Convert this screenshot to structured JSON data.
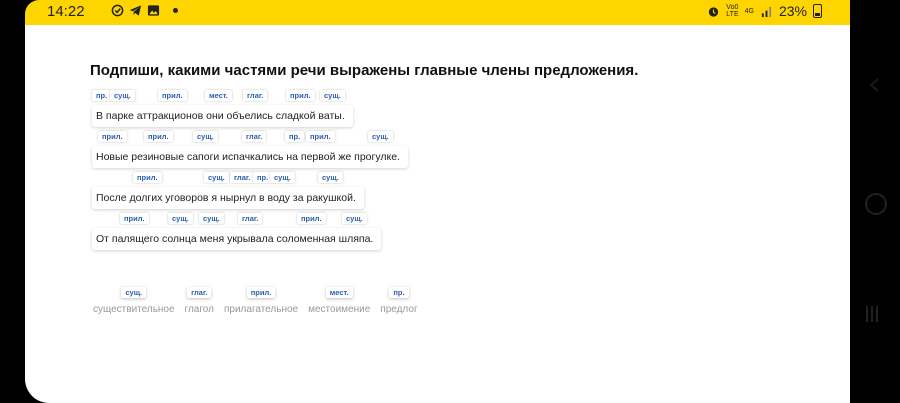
{
  "status_bar": {
    "time": "14:22",
    "left_icons": [
      "check-circle-icon",
      "telegram-icon",
      "image-icon"
    ],
    "network_small_1": "Vo0",
    "network_small_2": "LTE",
    "network_gen": "4G",
    "battery": "23%"
  },
  "task": {
    "title": "Подпиши, какими частями речи выражены главные члены предложения."
  },
  "sentences": [
    {
      "text": "В парке аттракционов они объелись сладкой ваты.",
      "tags": [
        "пр.",
        "сущ.",
        "прил.",
        "мест.",
        "глаг.",
        "прил.",
        "сущ."
      ]
    },
    {
      "text": "Новые резиновые сапоги испачкались на первой же прогулке.",
      "tags": [
        "прил.",
        "прил.",
        "сущ.",
        "глаг.",
        "пр.",
        "прил.",
        "сущ."
      ]
    },
    {
      "text": "После долгих уговоров я нырнул в воду за ракушкой.",
      "tags": [
        "прил.",
        "сущ.",
        "глаг.",
        "пр.",
        "сущ.",
        "сущ."
      ]
    },
    {
      "text": "От палящего солнца меня укрывала соломенная шляпа.",
      "tags": [
        "прил.",
        "сущ.",
        "сущ.",
        "глаг.",
        "прил.",
        "сущ."
      ]
    }
  ],
  "legend": [
    {
      "tag": "сущ.",
      "label": "существительное"
    },
    {
      "tag": "глаг.",
      "label": "глагол"
    },
    {
      "tag": "прил.",
      "label": "прилагательное"
    },
    {
      "tag": "мест.",
      "label": "местоимение"
    },
    {
      "tag": "пр.",
      "label": "предлог"
    }
  ],
  "colors": {
    "status_bar": "#ffd500",
    "tag_text": "#2b5fae",
    "legend_label": "#999999"
  }
}
